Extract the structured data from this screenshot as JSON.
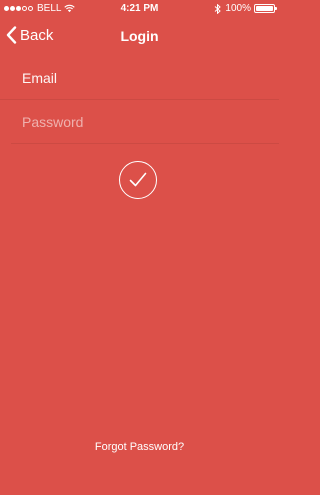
{
  "status_bar": {
    "carrier": "BELL",
    "time": "4:21 PM",
    "battery": "100%"
  },
  "nav": {
    "back_label": "Back",
    "title": "Login"
  },
  "form": {
    "email_placeholder": "Email",
    "password_placeholder": "Password"
  },
  "footer": {
    "forgot_label": "Forgot Password?"
  },
  "colors": {
    "background": "#dc5049",
    "foreground": "#ffffff"
  }
}
